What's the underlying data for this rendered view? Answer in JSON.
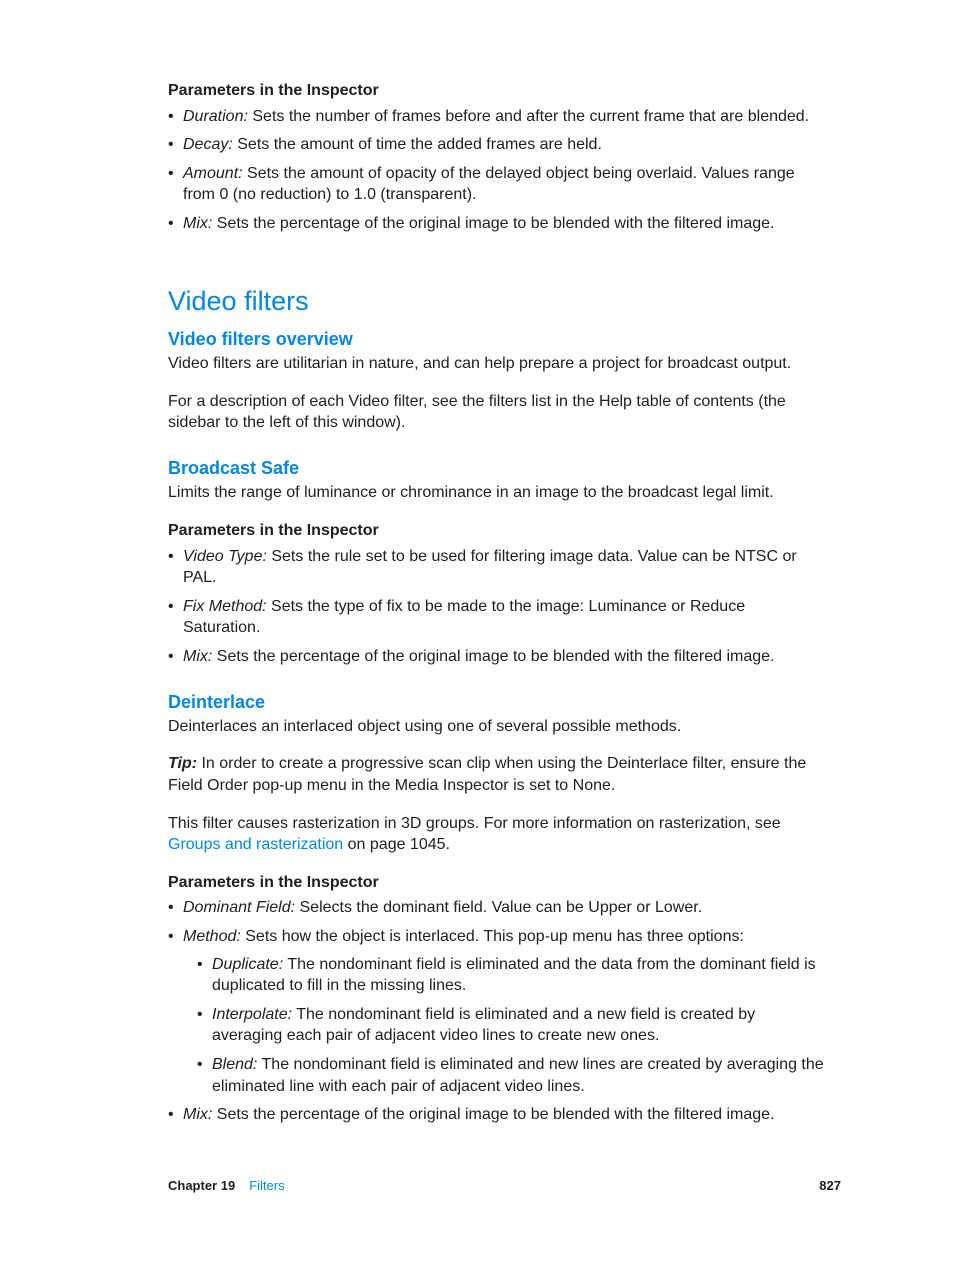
{
  "section1": {
    "heading": "Parameters in the Inspector",
    "items": [
      {
        "term": "Duration:",
        "desc": " Sets the number of frames before and after the current frame that are blended."
      },
      {
        "term": "Decay:",
        "desc": " Sets the amount of time the added frames are held."
      },
      {
        "term": "Amount:",
        "desc": " Sets the amount of opacity of the delayed object being overlaid. Values range from 0 (no reduction) to 1.0 (transparent)."
      },
      {
        "term": "Mix:",
        "desc": " Sets the percentage of the original image to be blended with the filtered image."
      }
    ]
  },
  "video_filters": {
    "title": "Video filters",
    "overview": {
      "title": "Video filters overview",
      "p1": "Video filters are utilitarian in nature, and can help prepare a project for broadcast output.",
      "p2": "For a description of each Video filter, see the filters list in the Help table of contents (the sidebar to the left of this window)."
    },
    "broadcast_safe": {
      "title": "Broadcast Safe",
      "desc": "Limits the range of luminance or chrominance in an image to the broadcast legal limit.",
      "param_heading": "Parameters in the Inspector",
      "items": [
        {
          "term": "Video Type:",
          "desc": " Sets the rule set to be used for filtering image data. Value can be NTSC or PAL."
        },
        {
          "term": "Fix Method:",
          "desc": " Sets the type of fix to be made to the image: Luminance or Reduce Saturation."
        },
        {
          "term": "Mix:",
          "desc": " Sets the percentage of the original image to be blended with the filtered image."
        }
      ]
    },
    "deinterlace": {
      "title": "Deinterlace",
      "desc": "Deinterlaces an interlaced object using one of several possible methods.",
      "tip_label": "Tip:  ",
      "tip_text": "In order to create a progressive scan clip when using the Deinterlace filter, ensure the Field Order pop-up menu in the Media Inspector is set to None.",
      "raster_pre": "This filter causes rasterization in 3D groups. For more information on rasterization, see ",
      "raster_link": "Groups and rasterization",
      "raster_post": " on page 1045.",
      "param_heading": "Parameters in the Inspector",
      "items": [
        {
          "term": "Dominant Field:",
          "desc": " Selects the dominant field. Value can be Upper or Lower."
        },
        {
          "term": "Method:",
          "desc": " Sets how the object is interlaced. This pop-up menu has three options:",
          "sub": [
            {
              "term": "Duplicate:",
              "desc": " The nondominant field is eliminated and the data from the dominant field is duplicated to fill in the missing lines."
            },
            {
              "term": "Interpolate:",
              "desc": " The nondominant field is eliminated and a new field is created by averaging each pair of adjacent video lines to create new ones."
            },
            {
              "term": "Blend:",
              "desc": " The nondominant field is eliminated and new lines are created by averaging the eliminated line with each pair of adjacent video lines."
            }
          ]
        },
        {
          "term": "Mix:",
          "desc": " Sets the percentage of the original image to be blended with the filtered image."
        }
      ]
    }
  },
  "footer": {
    "chapter_label": "Chapter 19",
    "chapter_topic": "Filters",
    "page_num": "827"
  }
}
